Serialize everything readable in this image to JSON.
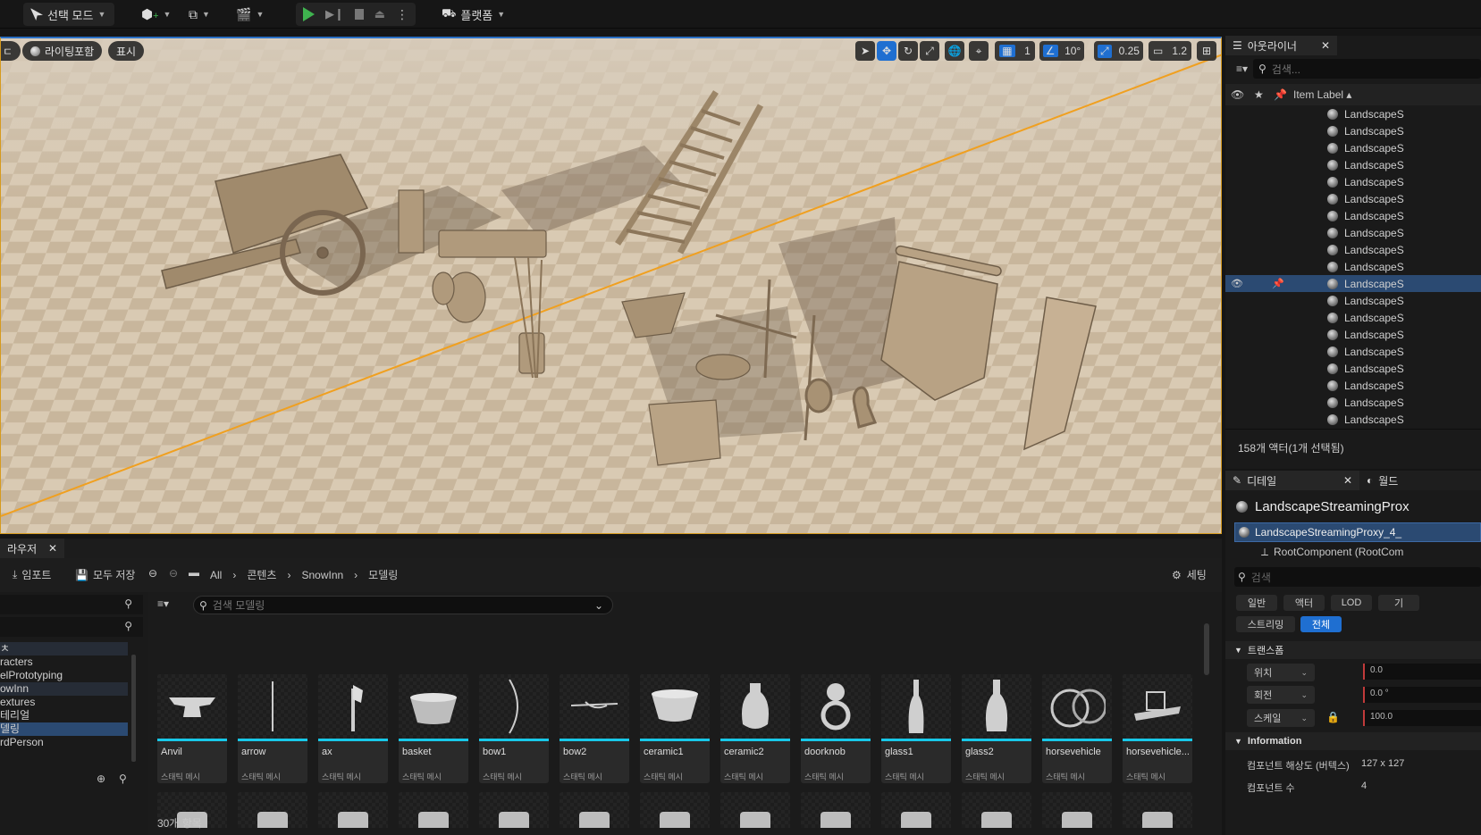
{
  "toolbar": {
    "select_mode": "선택 모드",
    "platform": "플랫폼"
  },
  "viewport": {
    "perspective_fragment": "ㄷ",
    "lighting": "라이팅포함",
    "show": "표시",
    "grid_snap": "1",
    "rotate_snap": "10°",
    "scale_snap": "0.25",
    "camera_speed": "1.2"
  },
  "outliner": {
    "tab_title": "아웃라이너",
    "search_placeholder": "검색...",
    "column_label": "Item Label",
    "rows": [
      "LandscapeS",
      "LandscapeS",
      "LandscapeS",
      "LandscapeS",
      "LandscapeS",
      "LandscapeS",
      "LandscapeS",
      "LandscapeS",
      "LandscapeS",
      "LandscapeS",
      "LandscapeS",
      "LandscapeS",
      "LandscapeS",
      "LandscapeS",
      "LandscapeS",
      "LandscapeS",
      "LandscapeS",
      "LandscapeS",
      "LandscapeS",
      "LandscapeS"
    ],
    "selected_index": 10,
    "status": "158개 액터(1개 선택됨)"
  },
  "details": {
    "tab_title": "디테일",
    "tab2": "월드",
    "actor_name": "LandscapeStreamingProx",
    "component_root": "LandscapeStreamingProxy_4_",
    "component_child": "RootComponent (RootCom",
    "search_placeholder": "검색",
    "filters": [
      "일반",
      "액터",
      "LOD",
      "기"
    ],
    "filters2": [
      "스트리밍",
      "전체"
    ],
    "section_transform": "트랜스폼",
    "location_label": "위치",
    "location_value": "0.0",
    "rotation_label": "회전",
    "rotation_value": "0.0 °",
    "scale_label": "스케일",
    "scale_value": "100.0",
    "section_info": "Information",
    "res_label": "컴포넌트 해상도 (버텍스)",
    "res_value": "127 x 127",
    "count_label": "컴포넌트 수",
    "count_value": "4"
  },
  "content_browser": {
    "tab_title": "라우저",
    "import": "임포트",
    "save_all": "모두 저장",
    "breadcrumb": [
      "All",
      "콘텐츠",
      "SnowInn",
      "모델링"
    ],
    "settings": "세팅",
    "search_placeholder": "검색 모델링",
    "tree": [
      "ㅊ",
      "racters",
      "elPrototyping",
      "owInn",
      "extures",
      "테리얼",
      "델링",
      "rdPerson"
    ],
    "tree_selected": 6,
    "assets": [
      {
        "name": "Anvil",
        "type": "스태틱 메시"
      },
      {
        "name": "arrow",
        "type": "스태틱 메시"
      },
      {
        "name": "ax",
        "type": "스태틱 메시"
      },
      {
        "name": "basket",
        "type": "스태틱 메시"
      },
      {
        "name": "bow1",
        "type": "스태틱 메시"
      },
      {
        "name": "bow2",
        "type": "스태틱 메시"
      },
      {
        "name": "ceramic1",
        "type": "스태틱 메시"
      },
      {
        "name": "ceramic2",
        "type": "스태틱 메시"
      },
      {
        "name": "doorknob",
        "type": "스태틱 메시"
      },
      {
        "name": "glass1",
        "type": "스태틱 메시"
      },
      {
        "name": "glass2",
        "type": "스태틱 메시"
      },
      {
        "name": "horsevehicle",
        "type": "스태틱 메시"
      },
      {
        "name": "horsevehicle...",
        "type": "스태틱 메시"
      }
    ],
    "item_count": "30개 항목"
  },
  "colors": {
    "accent_blue": "#1f6fd1",
    "cyan_bar": "#18c8e8",
    "play_green": "#3fb34f",
    "selection": "#2b4a72"
  }
}
